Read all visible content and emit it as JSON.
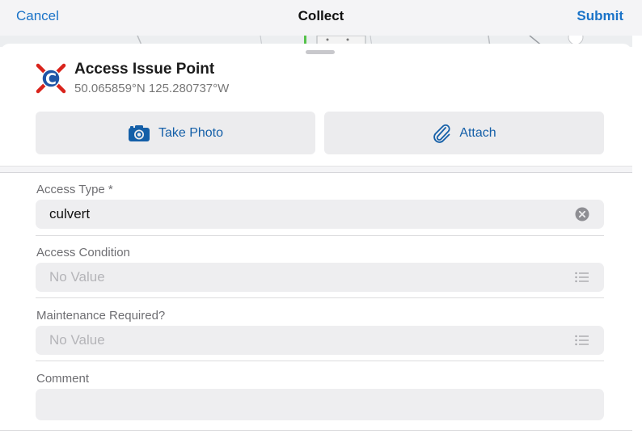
{
  "navbar": {
    "cancel_label": "Cancel",
    "title": "Collect",
    "submit_label": "Submit"
  },
  "feature": {
    "title": "Access Issue Point",
    "coordinates": "50.065859°N  125.280737°W",
    "icon": "culvert-blocked-icon",
    "icon_letter": "C"
  },
  "actions": {
    "take_photo_label": "Take Photo",
    "attach_label": "Attach"
  },
  "form": {
    "access_type": {
      "label": "Access Type *",
      "value": "culvert"
    },
    "access_condition": {
      "label": "Access Condition",
      "placeholder": "No Value"
    },
    "maintenance_required": {
      "label": "Maintenance Required?",
      "placeholder": "No Value"
    },
    "comment": {
      "label": "Comment",
      "value": ""
    }
  },
  "colors": {
    "accent": "#1a73c8",
    "button_text": "#145fa8",
    "icon_red": "#d9241c",
    "icon_blue": "#1f55a6"
  }
}
